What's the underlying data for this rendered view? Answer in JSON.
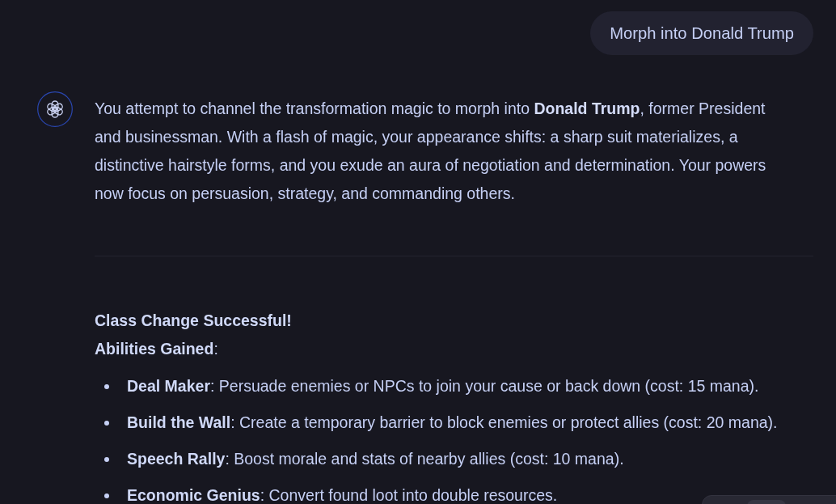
{
  "conversation": {
    "user_message": "Morph into Donald Trump",
    "assistant": {
      "paragraph": "You attempt to channel the transformation magic to morph into **Donald Trump**, former President and businessman. With a flash of magic, your appearance shifts: a sharp suit materializes, a distinctive hairstyle forms, and you exude an aura of negotiation and determination. Your powers now focus on persuasion, strategy, and commanding others.",
      "heading": "Class Change Successful!",
      "subheading": "**Abilities Gained**:",
      "abilities": [
        "**Deal Maker**: Persuade enemies or NPCs to join your cause or back down (cost: 15 mana).",
        "**Build the Wall**: Create a temporary barrier to block enemies or protect allies (cost: 20 mana).",
        "**Speech Rally**: Boost morale and stats of nearby allies (cost: 10 mana).",
        "**Economic Genius**: Convert found loot into double resources."
      ]
    }
  }
}
